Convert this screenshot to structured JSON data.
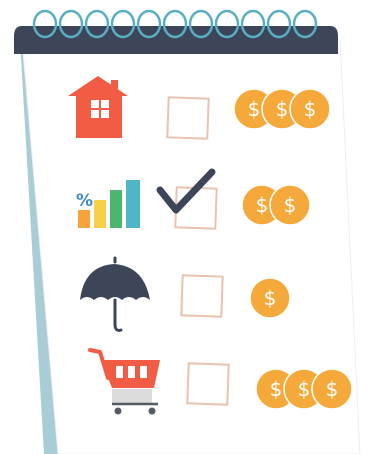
{
  "notepad": {
    "cover_color": "#3d4558",
    "page_color": "#ffffff",
    "spine_color": "#a8cdd6",
    "ring_color": "#5aaec4",
    "ring_count": 11
  },
  "checklist": {
    "checkbox_border_color": "#e8c3ad",
    "checkmark_color": "#3d4558",
    "coin_color": "#f5a93b",
    "coin_symbol_color": "#ffffff",
    "items": [
      {
        "icon": "house-icon",
        "checked": false,
        "coins": 3,
        "symbol": "$"
      },
      {
        "icon": "investment-chart-icon",
        "checked": true,
        "coins": 2,
        "symbol": "$"
      },
      {
        "icon": "umbrella-icon",
        "checked": false,
        "coins": 1,
        "symbol": "$"
      },
      {
        "icon": "shopping-cart-icon",
        "checked": false,
        "coins": 3,
        "symbol": "$"
      }
    ]
  },
  "chart_icon": {
    "percent_label": "%",
    "bar_colors": [
      "#f7a23b",
      "#f7d04a",
      "#4cb66f",
      "#4fb6c8"
    ]
  }
}
